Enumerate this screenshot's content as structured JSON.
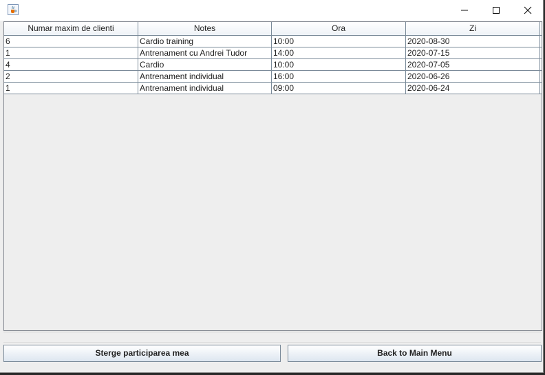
{
  "window": {
    "icon": "java-cup-icon",
    "controls": [
      "minimize-icon",
      "maximize-icon",
      "close-icon"
    ]
  },
  "table": {
    "columns": [
      "Numar maxim de clienti",
      "Notes",
      "Ora",
      "Zi"
    ],
    "rows": [
      [
        "6",
        "Cardio training",
        "10:00",
        "2020-08-30"
      ],
      [
        "1",
        "Antrenament cu Andrei Tudor",
        "14:00",
        "2020-07-15"
      ],
      [
        "4",
        "Cardio",
        "10:00",
        "2020-07-05"
      ],
      [
        "2",
        "Antrenament individual",
        "16:00",
        "2020-06-26"
      ],
      [
        "1",
        "Antrenament individual",
        "09:00",
        "2020-06-24"
      ]
    ]
  },
  "buttons": {
    "delete_label": "Sterge participarea mea",
    "back_label": "Back to Main Menu"
  }
}
